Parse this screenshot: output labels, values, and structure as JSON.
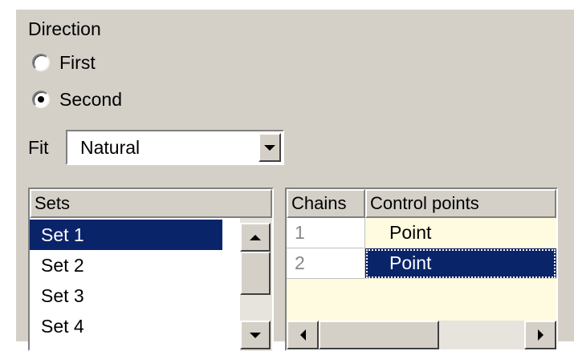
{
  "direction": {
    "label": "Direction",
    "options": [
      {
        "label": "First",
        "checked": false
      },
      {
        "label": "Second",
        "checked": true
      }
    ]
  },
  "fit": {
    "label": "Fit",
    "value": "Natural"
  },
  "sets": {
    "header": "Sets",
    "items": [
      "Set 1",
      "Set 2",
      "Set 3",
      "Set 4"
    ],
    "selected_index": 0
  },
  "chains": {
    "headers": [
      "Chains",
      "Control points"
    ],
    "rows": [
      {
        "num": "1",
        "value": "Point"
      },
      {
        "num": "2",
        "value": "Point"
      }
    ],
    "selected_row": 1
  },
  "colors": {
    "panel_bg": "#d4d0c8",
    "selection": "#0a246a",
    "grid_bg": "#fffbe0"
  },
  "icons": [
    "radio-icon",
    "chevron-down-icon",
    "arrow-up-icon",
    "arrow-down-icon",
    "arrow-left-icon",
    "arrow-right-icon"
  ]
}
